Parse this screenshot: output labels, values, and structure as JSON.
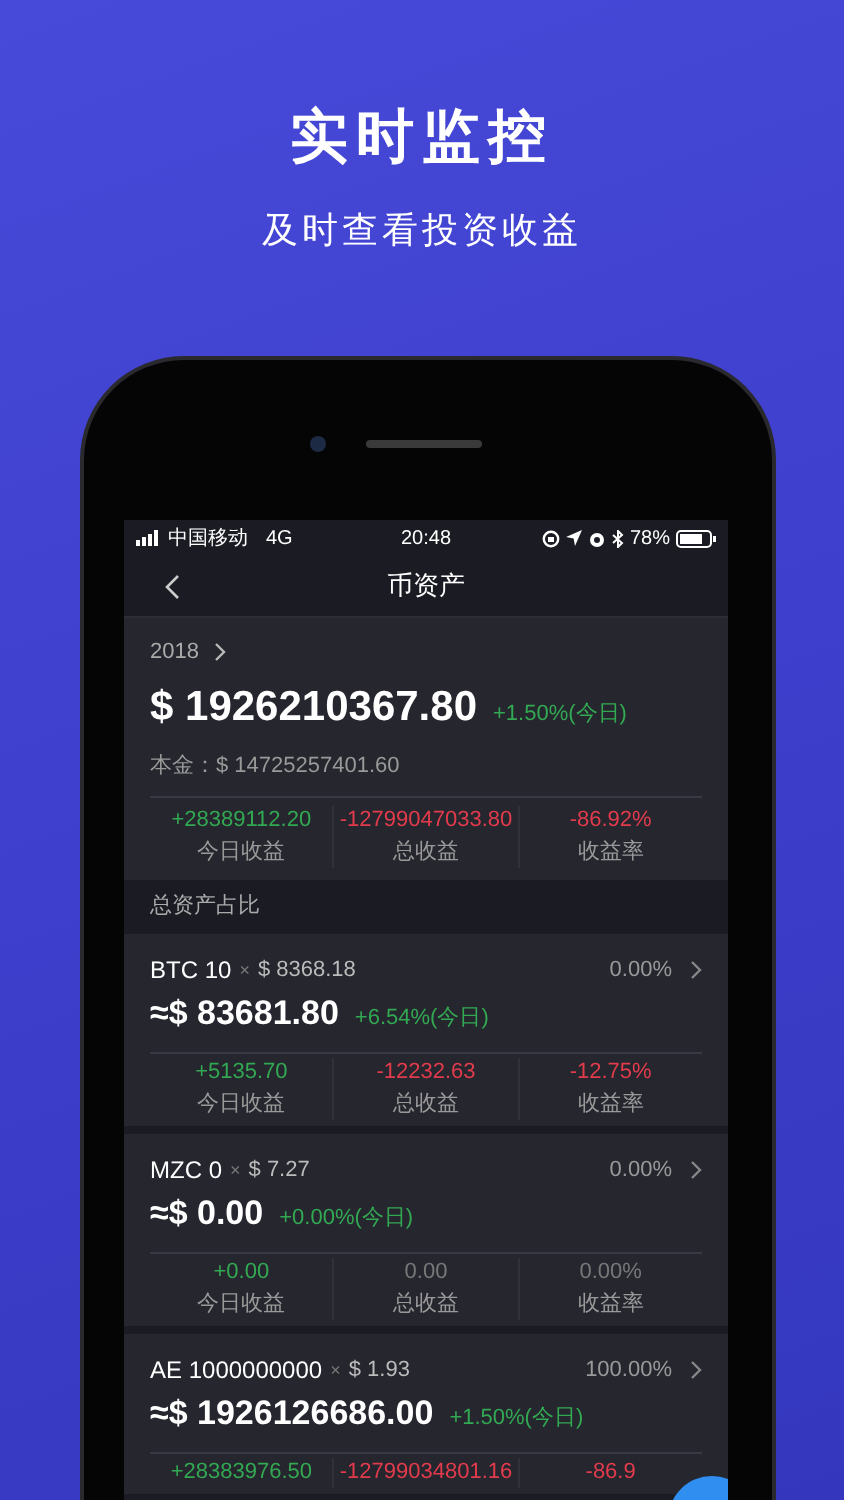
{
  "promo": {
    "title": "实时监控",
    "subtitle": "及时查看投资收益"
  },
  "status_bar": {
    "carrier": "中国移动",
    "network": "4G",
    "time": "20:48",
    "battery": "78%"
  },
  "nav": {
    "title": "币资产"
  },
  "summary": {
    "year": "2018",
    "total": "$ 1926210367.80",
    "change": "+1.50%(今日)",
    "principal": "本金：$ 14725257401.60",
    "stats": [
      {
        "value": "+28389112.20",
        "label": "今日收益",
        "kind": "gain"
      },
      {
        "value": "-12799047033.80",
        "label": "总收益",
        "kind": "loss"
      },
      {
        "value": "-86.92%",
        "label": "收益率",
        "kind": "loss"
      }
    ]
  },
  "section_header": "总资产占比",
  "assets": [
    {
      "name": "BTC 10",
      "times": "×",
      "price": "$ 8368.18",
      "share": "0.00%",
      "amount": "≈$ 83681.80",
      "change": "+6.54%(今日)",
      "stats": [
        {
          "value": "+5135.70",
          "label": "今日收益",
          "kind": "gain"
        },
        {
          "value": "-12232.63",
          "label": "总收益",
          "kind": "loss"
        },
        {
          "value": "-12.75%",
          "label": "收益率",
          "kind": "loss"
        }
      ]
    },
    {
      "name": "MZC 0",
      "times": "×",
      "price": "$ 7.27",
      "share": "0.00%",
      "amount": "≈$ 0.00",
      "change": "+0.00%(今日)",
      "stats": [
        {
          "value": "+0.00",
          "label": "今日收益",
          "kind": "gain"
        },
        {
          "value": "0.00",
          "label": "总收益",
          "kind": "neutral"
        },
        {
          "value": "0.00%",
          "label": "收益率",
          "kind": "neutral"
        }
      ]
    },
    {
      "name": "AE 1000000000",
      "times": "×",
      "price": "$ 1.93",
      "share": "100.00%",
      "amount": "≈$ 1926126686.00",
      "change": "+1.50%(今日)",
      "stats": [
        {
          "value": "+28383976.50",
          "kind": "gain"
        },
        {
          "value": "-12799034801.16",
          "kind": "loss"
        },
        {
          "value": "-86.9",
          "kind": "loss"
        }
      ]
    }
  ]
}
